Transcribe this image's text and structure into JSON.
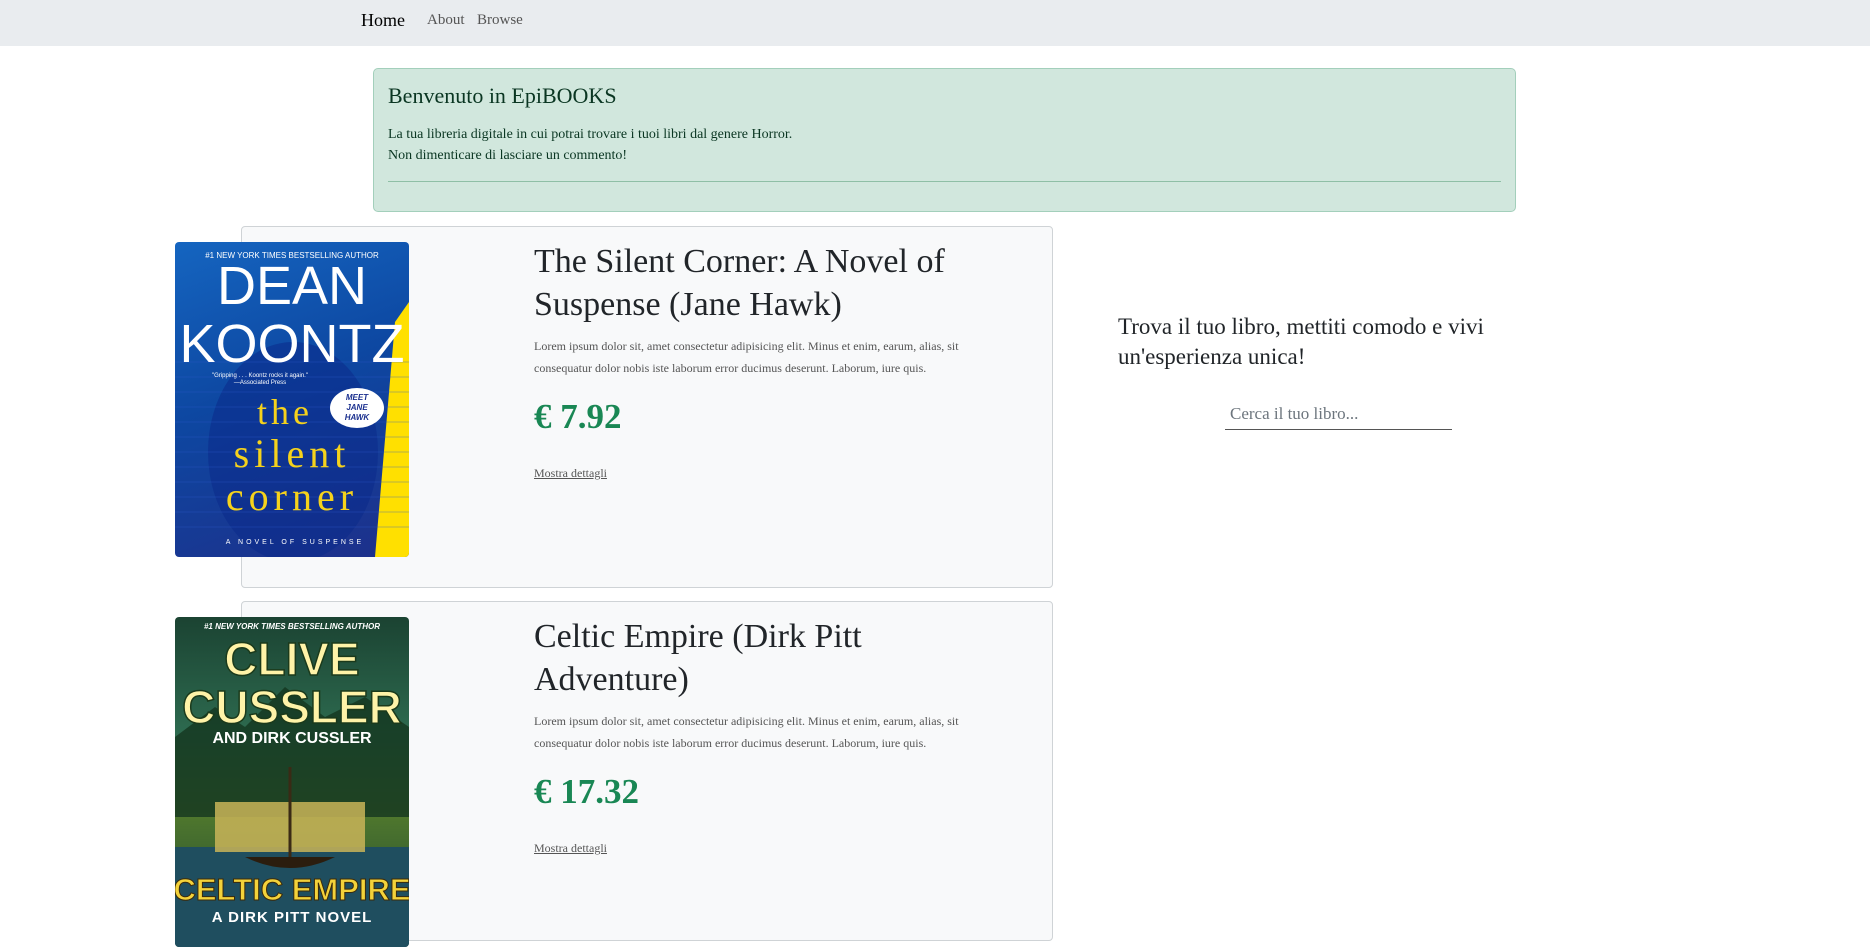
{
  "nav": {
    "brand": "Home",
    "links": [
      "About",
      "Browse"
    ]
  },
  "welcome": {
    "title": "Benvenuto in EpiBOOKS",
    "line1": "La tua libreria digitale in cui potrai trovare i tuoi libri dal genere Horror.",
    "line2": "Non dimenticare di lasciare un commento!"
  },
  "books": [
    {
      "title": "The Silent Corner: A Novel of Suspense (Jane Hawk)",
      "description": "Lorem ipsum dolor sit, amet consectetur adipisicing elit. Minus et enim, earum, alias, sit consequatur dolor nobis iste laborum error ducimus deserunt. Laborum, iure quis.",
      "price": "€ 7.92",
      "details_label": "Mostra dettagli",
      "cover": {
        "top_line": "#1 NEW YORK TIMES BESTSELLING AUTHOR",
        "author_1": "DEAN",
        "author_2": "KOONTZ",
        "quote": "\"Gripping . . . Koontz rocks it again.\"",
        "quote_source": "—Associated Press",
        "badge": [
          "MEET",
          "JANE",
          "HAWK"
        ],
        "title_words": [
          "the",
          "silent",
          "corner"
        ],
        "subtitle": "A NOVEL OF SUSPENSE"
      }
    },
    {
      "title": "Celtic Empire (Dirk Pitt Adventure)",
      "description": "Lorem ipsum dolor sit, amet consectetur adipisicing elit. Minus et enim, earum, alias, sit consequatur dolor nobis iste laborum error ducimus deserunt. Laborum, iure quis.",
      "price": "€ 17.32",
      "details_label": "Mostra dettagli",
      "cover": {
        "top_line": "#1 NEW YORK TIMES BESTSELLING AUTHOR",
        "author_1": "CLIVE",
        "author_2": "CUSSLER",
        "coauthor": "AND DIRK CUSSLER",
        "title": "CELTIC EMPIRE",
        "subtitle": "A DIRK PITT NOVEL"
      }
    }
  ],
  "sidebar": {
    "title": "Trova il tuo libro, mettiti comodo e vivi un'esperienza unica!",
    "search_placeholder": "Cerca il tuo libro..."
  },
  "colors": {
    "price": "#198754",
    "welcome_bg": "#d1e7dd",
    "navbar_bg": "#e9ecef"
  }
}
